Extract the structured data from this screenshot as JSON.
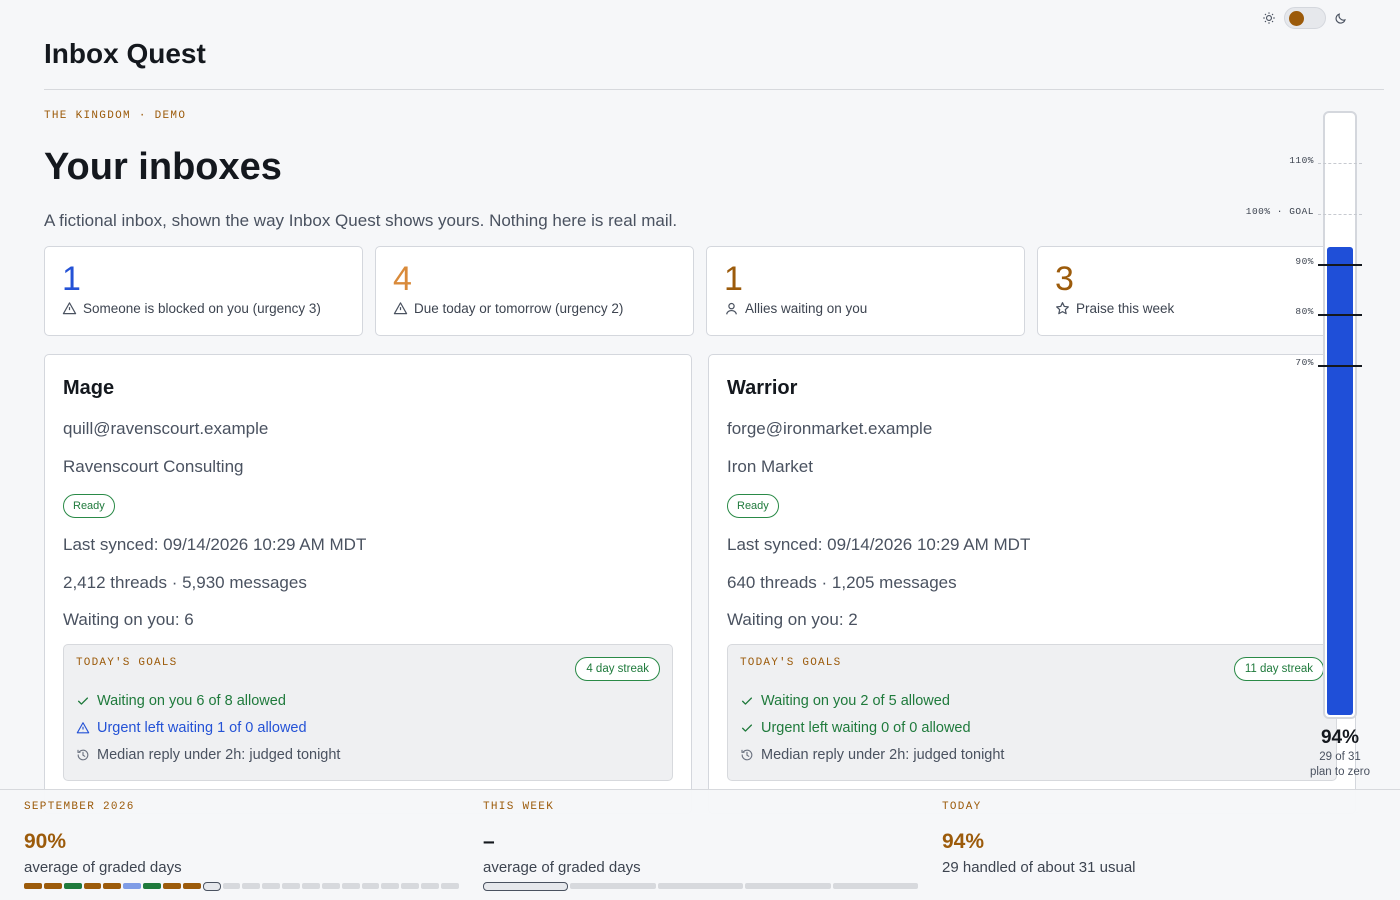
{
  "app": {
    "title": "Inbox Quest"
  },
  "theme": {
    "knob_color": "#9c5b0b"
  },
  "header": {
    "eyebrow": "THE KINGDOM · DEMO",
    "title": "Your inboxes",
    "subtitle": "A fictional inbox, shown the way Inbox Quest shows yours. Nothing here is real mail."
  },
  "stats": [
    {
      "value": "1",
      "label": "Someone is blocked on you (urgency 3)",
      "icon": "warning-icon",
      "color": "#2452d6"
    },
    {
      "value": "4",
      "label": "Due today or tomorrow (urgency 2)",
      "icon": "warning-icon",
      "color": "#d98a3a"
    },
    {
      "value": "1",
      "label": "Allies waiting on you",
      "icon": "user-icon",
      "color": "#9c5b0b"
    },
    {
      "value": "3",
      "label": "Praise this week",
      "icon": "star-icon",
      "color": "#9c5b0b"
    }
  ],
  "inboxes": [
    {
      "name": "Mage",
      "email": "quill@ravenscourt.example",
      "org": "Ravenscourt Consulting",
      "status": "Ready",
      "last_synced": "Last synced: 09/14/2026 10:29 AM MDT",
      "counts": "2,412 threads · 5,930 messages",
      "waiting": "Waiting on you: 6",
      "goals_title": "TODAY'S GOALS",
      "streak": "4 day streak",
      "goals": [
        {
          "state": "ok",
          "icon": "check-icon",
          "text": "Waiting on you 6 of 8 allowed"
        },
        {
          "state": "warn",
          "icon": "warning-icon",
          "text": "Urgent left waiting 1 of 0 allowed"
        },
        {
          "state": "wait",
          "icon": "history-icon",
          "text": "Median reply under 2h: judged tonight"
        }
      ]
    },
    {
      "name": "Warrior",
      "email": "forge@ironmarket.example",
      "org": "Iron Market",
      "status": "Ready",
      "last_synced": "Last synced: 09/14/2026 10:29 AM MDT",
      "counts": "640 threads · 1,205 messages",
      "waiting": "Waiting on you: 2",
      "goals_title": "TODAY'S GOALS",
      "streak": "11 day streak",
      "goals": [
        {
          "state": "ok",
          "icon": "check-icon",
          "text": "Waiting on you 2 of 5 allowed"
        },
        {
          "state": "ok",
          "icon": "check-icon",
          "text": "Urgent left waiting 0 of 0 allowed"
        },
        {
          "state": "wait",
          "icon": "history-icon",
          "text": "Median reply under 2h: judged tonight"
        }
      ]
    }
  ],
  "gauge": {
    "value_pct": 94,
    "scale_max_pct": 120,
    "fill_color": "#1f4fd8",
    "ticks": [
      {
        "pct": 110,
        "label": "110%",
        "style": "dash"
      },
      {
        "pct": 100,
        "label": "100% · GOAL",
        "style": "dash"
      },
      {
        "pct": 90,
        "label": "90%",
        "style": "solid"
      },
      {
        "pct": 80,
        "label": "80%",
        "style": "solid"
      },
      {
        "pct": 70,
        "label": "70%",
        "style": "solid"
      }
    ],
    "pct_label": "94%",
    "count_label": "29 of 31",
    "plan_label": "plan to zero"
  },
  "bottom": {
    "month": {
      "heading": "SEPTEMBER 2026",
      "value": "90%",
      "sub": "average of graded days",
      "days": [
        "gold",
        "gold",
        "green",
        "gold",
        "gold",
        "blue",
        "green",
        "gold",
        "gold",
        "current",
        "empty",
        "empty",
        "empty",
        "empty",
        "empty",
        "empty",
        "empty",
        "empty",
        "empty",
        "empty",
        "empty",
        "empty"
      ]
    },
    "week": {
      "heading": "THIS WEEK",
      "value": "–",
      "sub": "average of graded days",
      "days": [
        "current",
        "empty",
        "empty",
        "empty",
        "empty"
      ]
    },
    "today": {
      "heading": "TODAY",
      "value": "94%",
      "sub": "29 handled of about 31 usual"
    },
    "colors": {
      "gold": "#9c5b0b",
      "green": "#1f7a3c",
      "blue": "#7f9ce6",
      "empty": "#d7d9dd"
    }
  }
}
